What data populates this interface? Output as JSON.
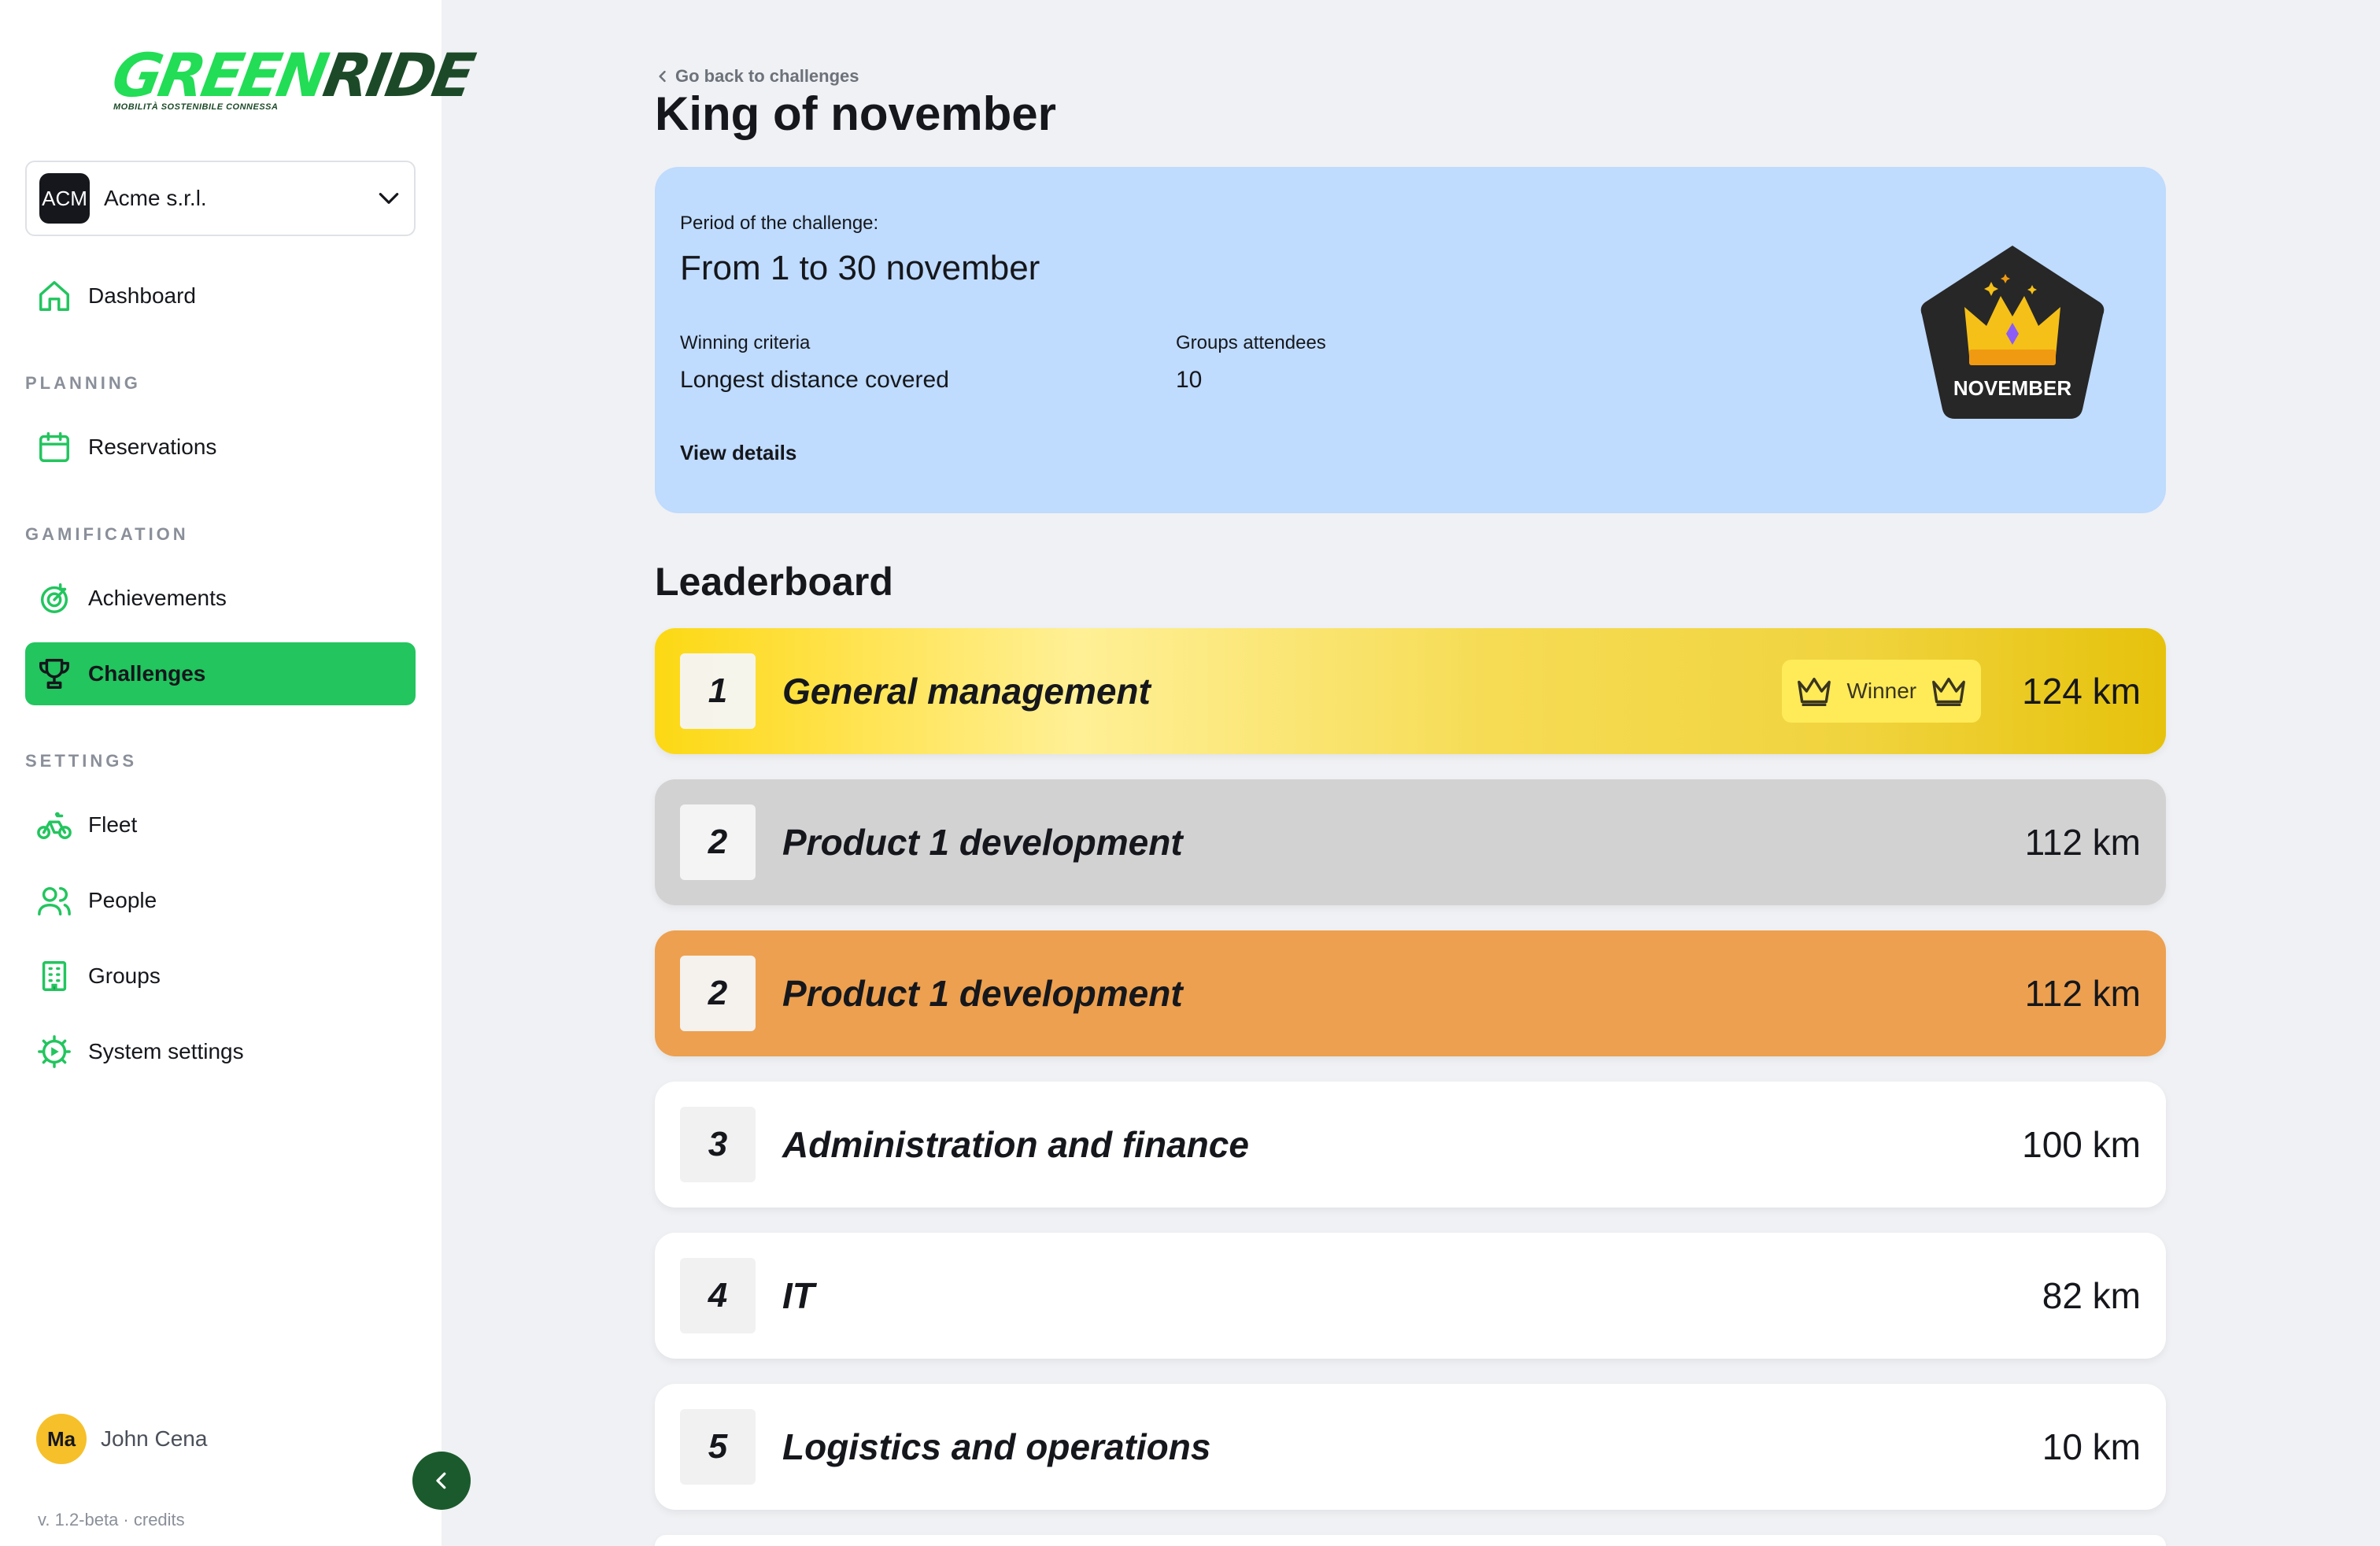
{
  "brand": {
    "logo_green": "GREEN",
    "logo_dark": "RIDE",
    "tagline": "MOBILITÀ SOSTENIBILE CONNESSA"
  },
  "org": {
    "badge": "ACM",
    "name": "Acme s.r.l."
  },
  "nav": {
    "dashboard": "Dashboard",
    "planning_title": "PLANNING",
    "reservations": "Reservations",
    "gamification_title": "GAMIFICATION",
    "achievements": "Achievements",
    "challenges": "Challenges",
    "settings_title": "SETTINGS",
    "fleet": "Fleet",
    "people": "People",
    "groups": "Groups",
    "system_settings": "System settings"
  },
  "user": {
    "initials": "Ma",
    "name": "John Cena"
  },
  "version": "v. 1.2-beta · credits",
  "back_link": "Go back to challenges",
  "page_title": "King of november",
  "challenge": {
    "period_label": "Period of the challenge:",
    "period_value": "From 1 to 30 november",
    "criteria_label": "Winning criteria",
    "criteria_value": "Longest distance covered",
    "groups_label": "Groups attendees",
    "groups_value": "10",
    "view_details": "View details",
    "badge_label": "NOVEMBER"
  },
  "leaderboard": {
    "title": "Leaderboard",
    "winner_label": "Winner",
    "rows": [
      {
        "rank": "1",
        "team": "General management",
        "distance": "124 km"
      },
      {
        "rank": "2",
        "team": "Product 1 development",
        "distance": "112 km"
      },
      {
        "rank": "2",
        "team": "Product 1 development",
        "distance": "112 km"
      },
      {
        "rank": "3",
        "team": "Administration and finance",
        "distance": "100 km"
      },
      {
        "rank": "4",
        "team": "IT",
        "distance": "82 km"
      },
      {
        "rank": "5",
        "team": "Logistics and operations",
        "distance": "10 km"
      }
    ]
  },
  "colors": {
    "accent": "#22c55e",
    "card": "#bfdbfe",
    "gold": "#fcd813",
    "silver": "#d3d2d3",
    "bronze": "#eda04f"
  }
}
